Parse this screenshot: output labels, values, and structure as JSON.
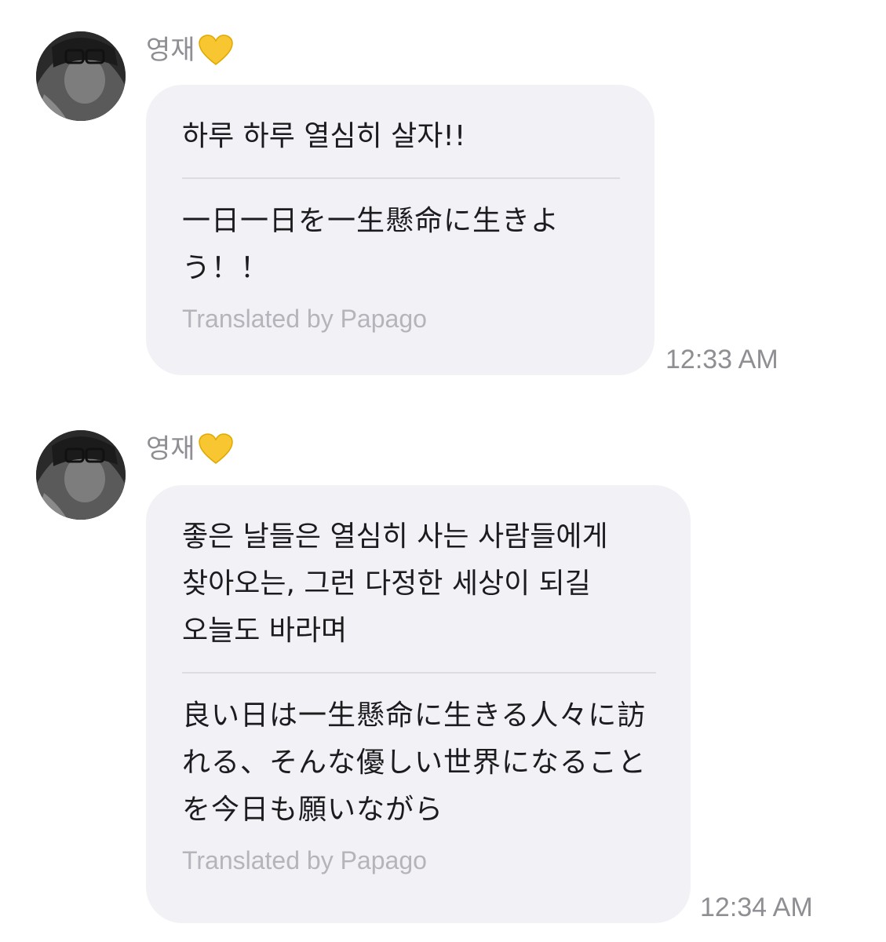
{
  "messages": [
    {
      "sender": "영재",
      "sender_icon": "yellow-heart-icon",
      "original": "하루 하루 열심히 살자!!",
      "translation": "一日一日を一生懸命に生きよう！！",
      "credit": "Translated by Papago",
      "time": "12:33 AM"
    },
    {
      "sender": "영재",
      "sender_icon": "yellow-heart-icon",
      "original": "좋은 날들은 열심히 사는 사람들에게 찾아오는, 그런 다정한 세상이 되길 오늘도 바라며",
      "translation": "良い日は一生懸命に生きる人々に訪れる、そんな優しい世界になることを今日も願いながら",
      "credit": "Translated by Papago",
      "time": "12:34 AM"
    }
  ],
  "colors": {
    "bubble": "#f2f2f6",
    "heart": "#f8c631",
    "meta_text": "#8e8e93",
    "credit_text": "#b4b4ba"
  }
}
